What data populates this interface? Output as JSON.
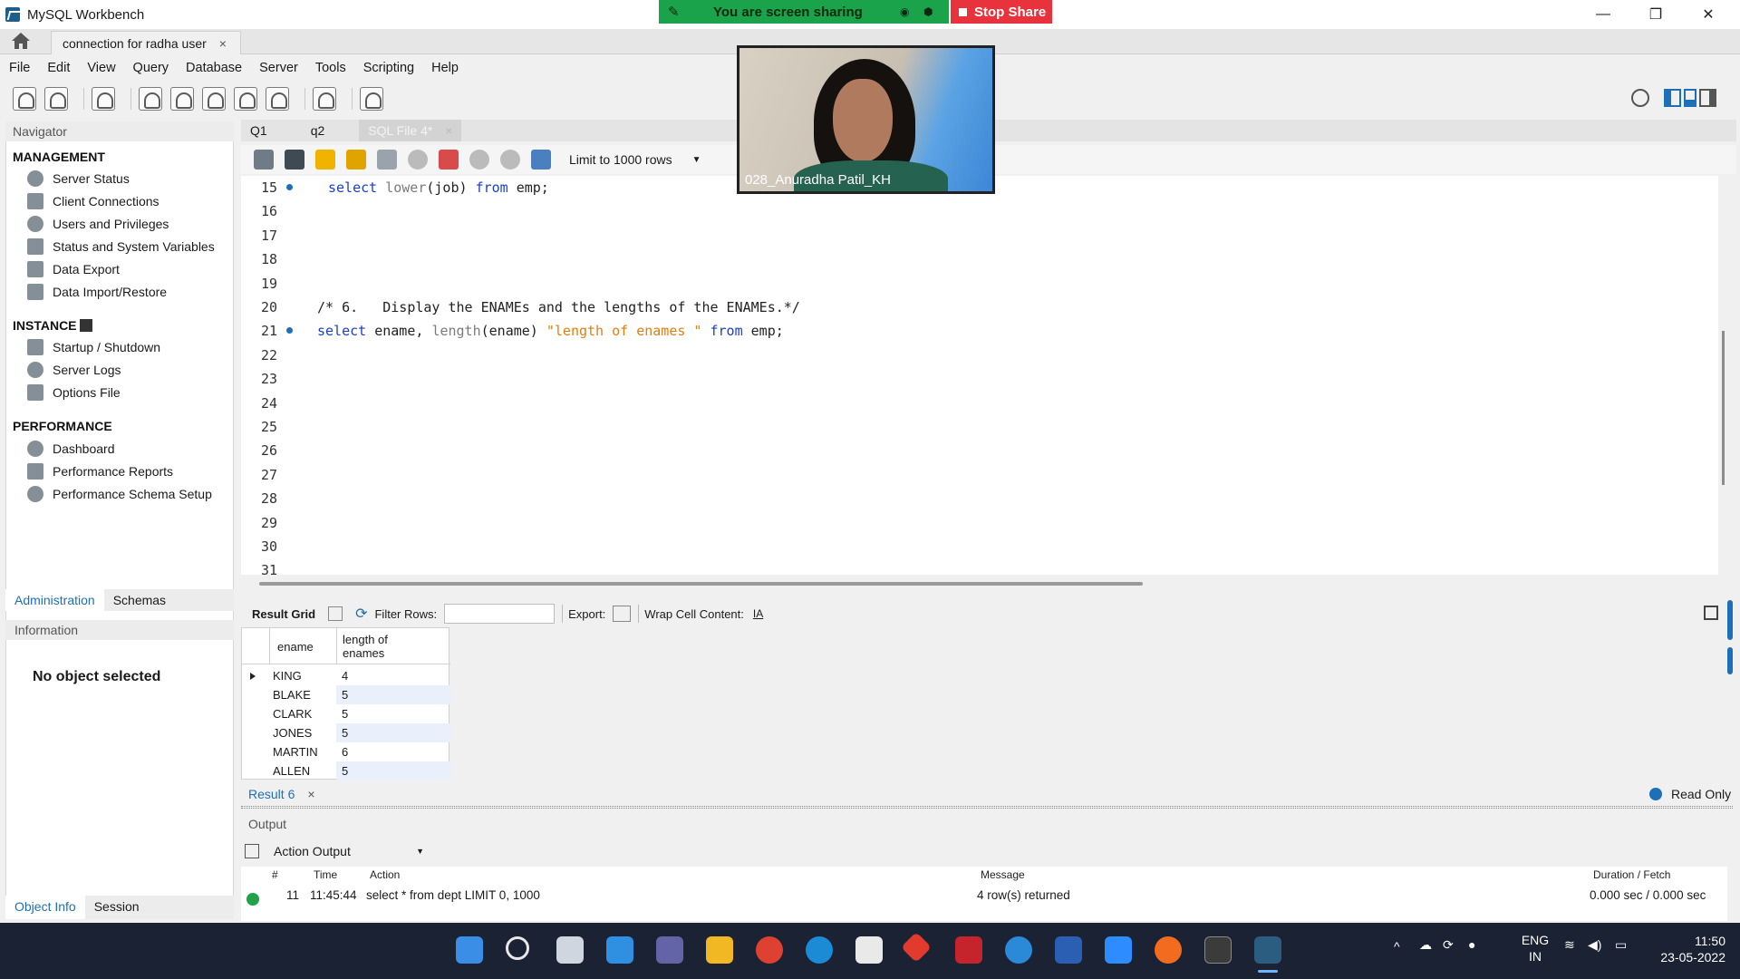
{
  "window": {
    "title": "MySQL Workbench"
  },
  "screen_share": {
    "status": "You are screen sharing",
    "stop_label": "Stop Share"
  },
  "connection_tab": {
    "label": "connection for radha  user",
    "close": "×"
  },
  "menu": [
    "File",
    "Edit",
    "View",
    "Query",
    "Database",
    "Server",
    "Tools",
    "Scripting",
    "Help"
  ],
  "navigator": {
    "header": "Navigator",
    "management": {
      "title": "MANAGEMENT",
      "items": [
        "Server Status",
        "Client Connections",
        "Users and Privileges",
        "Status and System Variables",
        "Data Export",
        "Data Import/Restore"
      ]
    },
    "instance": {
      "title": "INSTANCE",
      "items": [
        "Startup / Shutdown",
        "Server Logs",
        "Options File"
      ]
    },
    "performance": {
      "title": "PERFORMANCE",
      "items": [
        "Dashboard",
        "Performance Reports",
        "Performance Schema Setup"
      ]
    },
    "tabs": [
      "Administration",
      "Schemas"
    ],
    "info_header": "Information",
    "no_object": "No object selected",
    "bottom_tabs": [
      "Object Info",
      "Session"
    ]
  },
  "editor": {
    "tabs": [
      "Q1",
      "q2",
      "SQL File 4*"
    ],
    "tab_close": "×",
    "limit_label": "Limit to 1000 rows",
    "lines": [
      {
        "num": "15",
        "dot": true
      },
      {
        "num": "16"
      },
      {
        "num": "17"
      },
      {
        "num": "18"
      },
      {
        "num": "19"
      },
      {
        "num": "20"
      },
      {
        "num": "21",
        "dot": true
      },
      {
        "num": "22"
      },
      {
        "num": "23"
      },
      {
        "num": "24"
      },
      {
        "num": "25"
      },
      {
        "num": "26"
      },
      {
        "num": "27"
      },
      {
        "num": "28"
      },
      {
        "num": "29"
      },
      {
        "num": "30"
      },
      {
        "num": "31"
      }
    ],
    "code15": {
      "kw1": "select",
      "fn": "lower",
      "rest": "(job) ",
      "kw2": "from",
      "tail": " emp;"
    },
    "code20": "/* 6.   Display the ENAMEs and the lengths of the ENAMEs.*/",
    "code21": {
      "kw1": "select",
      "mid": " ename, ",
      "fn": "length",
      "args": "(ename) ",
      "str": "\"length of enames \"",
      "kw2": " from",
      "tail": " emp;"
    }
  },
  "result": {
    "toolbar": {
      "grid_label": "Result Grid",
      "filter_label": "Filter Rows:",
      "export_label": "Export:",
      "wrap_label": "Wrap Cell Content:"
    },
    "columns": [
      "ename",
      "length of",
      "enames"
    ],
    "rows": [
      {
        "ename": "KING",
        "len": "4"
      },
      {
        "ename": "BLAKE",
        "len": "5"
      },
      {
        "ename": "CLARK",
        "len": "5"
      },
      {
        "ename": "JONES",
        "len": "5"
      },
      {
        "ename": "MARTIN",
        "len": "6"
      },
      {
        "ename": "ALLEN",
        "len": "5"
      }
    ],
    "tab_label": "Result 6",
    "tab_close": "×",
    "readonly": "Read Only"
  },
  "output": {
    "header": "Output",
    "selector": "Action Output",
    "columns": [
      "#",
      "Time",
      "Action",
      "Message",
      "Duration / Fetch"
    ],
    "row": {
      "num": "11",
      "time": "11:45:44",
      "action": "select * from dept LIMIT 0, 1000",
      "message": "4 row(s) returned",
      "duration": "0.000 sec / 0.000 sec"
    }
  },
  "video": {
    "participant": "028_Anuradha Patil_KH"
  },
  "taskbar": {
    "lang": "ENG",
    "region": "IN",
    "time": "11:50",
    "date": "23-05-2022"
  },
  "colors": {
    "accent": "#1d6fb8",
    "keyword": "#1c3fc7",
    "string": "#e37e10",
    "share_green": "#1aa34a",
    "stop_red": "#e8323c",
    "taskbar": "#1a2233"
  }
}
